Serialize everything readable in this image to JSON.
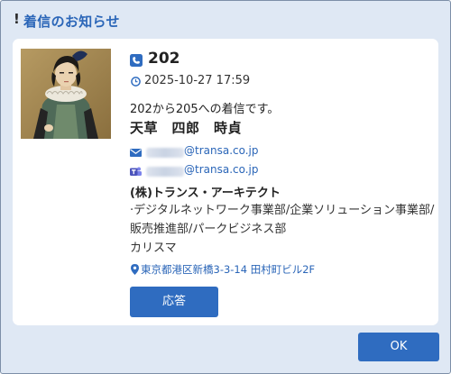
{
  "dialog": {
    "title_mark": "!",
    "title": "着信のお知らせ",
    "ok_label": "OK"
  },
  "caller": {
    "extension": "202",
    "timestamp": "2025-10-27 17:59",
    "message": "202から205への着信です。",
    "name": "天草　四郎　時貞",
    "email_domain": "@transa.co.jp",
    "chat_domain": "@transa.co.jp",
    "company": "(株)トランス・アーキテクト",
    "department": "·デジタルネットワーク事業部/企業ソリューション事業部/販売推進部/パークビジネス部",
    "title": "カリスマ",
    "address": "東京都港区新橋3-3-14 田村町ビル2F",
    "answer_label": "応答"
  },
  "icons": {
    "phone": "phone-icon",
    "clock": "clock-icon",
    "mail": "mail-icon",
    "teams": "teams-icon",
    "location": "map-pin-icon"
  },
  "colors": {
    "accent": "#2f6cc0",
    "link": "#2b66b8",
    "dialog_bg": "#dfe8f4",
    "card_bg": "#ffffff"
  }
}
